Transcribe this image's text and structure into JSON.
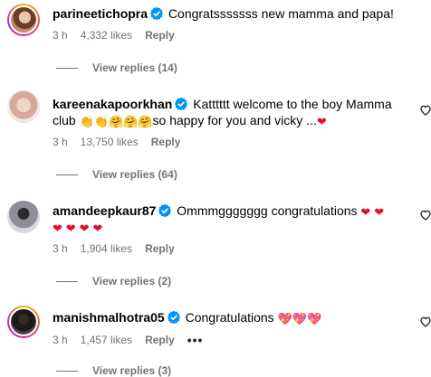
{
  "comments": [
    {
      "username": "parineetichopra",
      "text": "Congratsssssss new mamma and papa!",
      "time": "3 h",
      "likes": "4,332 likes",
      "reply": "Reply",
      "view_replies": "View replies (14)"
    },
    {
      "username": "kareenakapoorkhan",
      "text": "Katttttt welcome to the boy Mamma club",
      "text_after": "so happy for you and vicky ...",
      "time": "3 h",
      "likes": "13,750 likes",
      "reply": "Reply",
      "view_replies": "View replies (64)"
    },
    {
      "username": "amandeepkaur87",
      "text": "Ommmggggggg congratulations",
      "time": "3 h",
      "likes": "1,904 likes",
      "reply": "Reply",
      "view_replies": "View replies (2)"
    },
    {
      "username": "manishmalhotra05",
      "text": "Congratulations",
      "time": "3 h",
      "likes": "1,457 likes",
      "reply": "Reply",
      "more": "•••",
      "view_replies": "View replies (3)"
    }
  ],
  "icons": {
    "verified": "verified-badge-icon",
    "like": "heart-outline-icon",
    "clap": "👏",
    "hug": "🤗",
    "red_heart": "❤️",
    "sparkle_heart": "💖"
  },
  "colors": {
    "verified_blue": "#0095f6",
    "meta_gray": "#737373",
    "heart_red": "#e0112b"
  }
}
